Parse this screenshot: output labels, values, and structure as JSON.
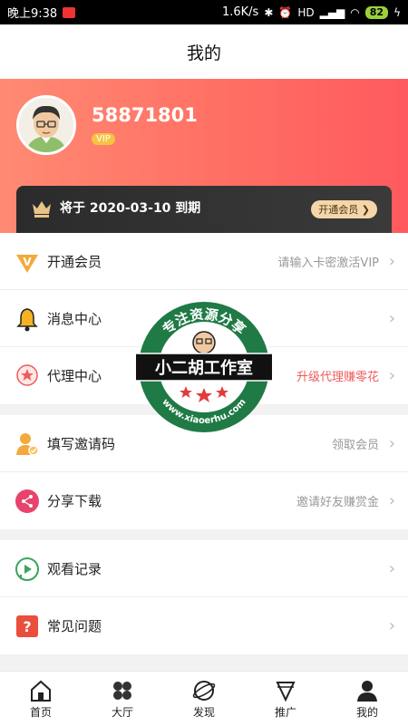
{
  "status_bar": {
    "time": "晚上9:38",
    "speed": "1.6K/s",
    "signal": "HD",
    "battery": "82"
  },
  "page_title": "我的",
  "profile": {
    "user_id": "58871801",
    "vip_label": "VIP"
  },
  "membership": {
    "expiry_text": "将于 2020-03-10 到期",
    "open_button": "开通会员"
  },
  "groups": [
    {
      "rows": [
        {
          "label": "开通会员",
          "hint": "请输入卡密激活VIP",
          "icon": "vip-icon"
        },
        {
          "label": "消息中心",
          "hint": "",
          "icon": "bell-icon"
        },
        {
          "label": "代理中心",
          "hint": "升级代理赚零花",
          "icon": "agent-icon"
        }
      ]
    },
    {
      "rows": [
        {
          "label": "填写邀请码",
          "hint": "领取会员",
          "icon": "invite-icon"
        },
        {
          "label": "分享下载",
          "hint": "邀请好友赚赏金",
          "icon": "share-icon"
        }
      ]
    },
    {
      "rows": [
        {
          "label": "观看记录",
          "hint": "",
          "icon": "history-icon"
        },
        {
          "label": "常见问题",
          "hint": "",
          "icon": "faq-icon"
        }
      ]
    }
  ],
  "watermark": {
    "top_text": "专注资源分享",
    "main_text": "小二胡工作室",
    "url_text": "www.xiaoerhu.com"
  },
  "bottom_nav": [
    {
      "label": "首页",
      "icon": "home-icon"
    },
    {
      "label": "大厅",
      "icon": "grid-icon"
    },
    {
      "label": "发现",
      "icon": "planet-icon"
    },
    {
      "label": "推广",
      "icon": "diamond-icon"
    },
    {
      "label": "我的",
      "icon": "user-icon"
    }
  ],
  "colors": {
    "header_gradient_start": "#ff8a73",
    "header_gradient_end": "#ff5a5f",
    "accent_red": "#f05a5a",
    "vip_gold": "#f5c542"
  }
}
